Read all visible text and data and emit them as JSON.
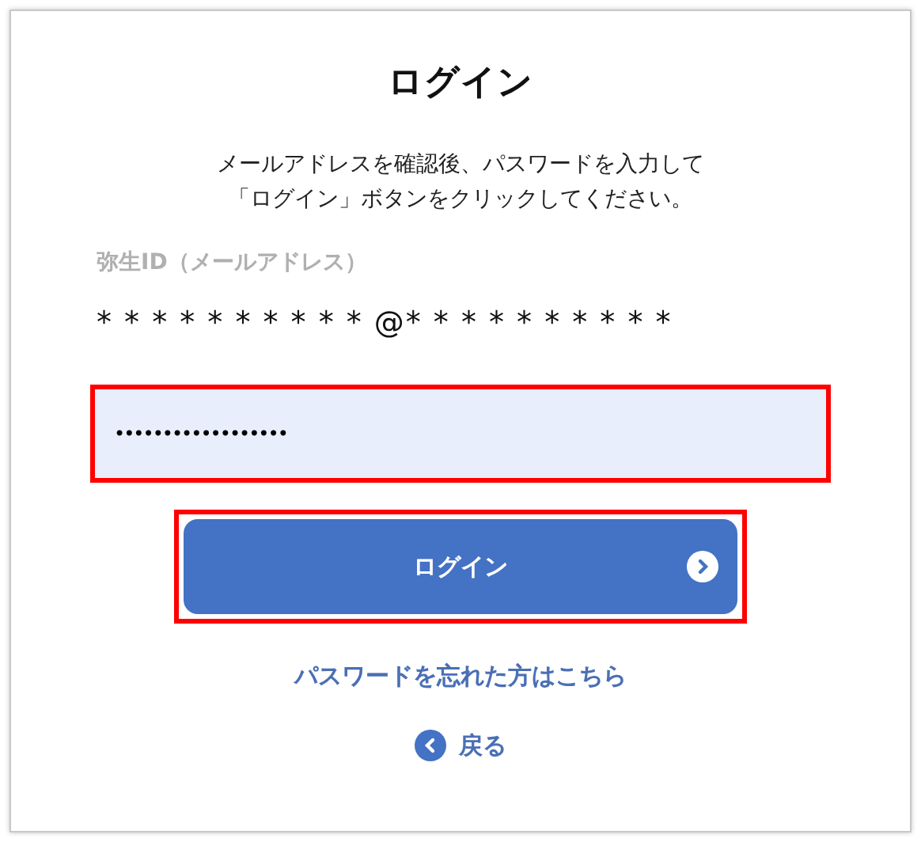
{
  "title": "ログイン",
  "instructions": [
    "メールアドレスを確認後、パスワードを入力して",
    "「ログイン」ボタンをクリックしてください。"
  ],
  "id_label": "弥生ID（メールアドレス）",
  "id_value": "* * * * * * * * * * @* * * * * * * * * *",
  "password": {
    "value": "••••••••••••••••••",
    "highlighted": true
  },
  "login_button": {
    "label": "ログイン",
    "highlighted": true
  },
  "forgot_link": "パスワードを忘れた方はこちら",
  "back_link": "戻る"
}
